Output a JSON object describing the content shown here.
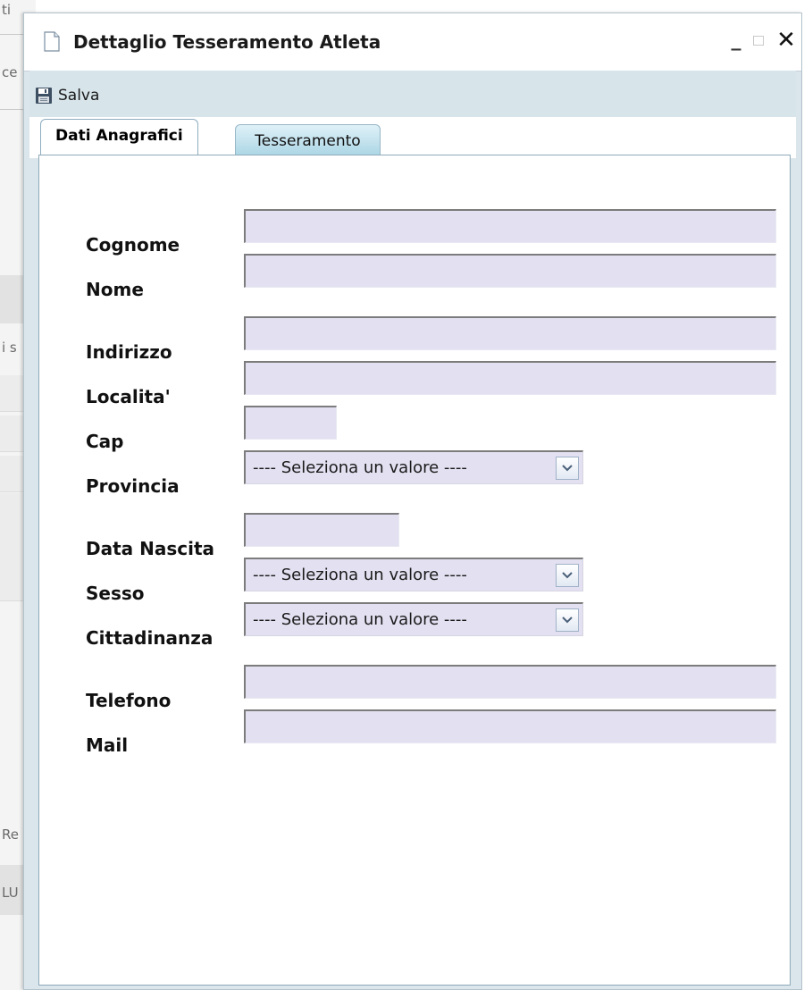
{
  "background": {
    "fragments": [
      "ti",
      "ce",
      "i s",
      "Re",
      "LU"
    ]
  },
  "window": {
    "title": "Dettaglio Tesseramento Atleta",
    "minimize_glyph": "_",
    "close_glyph": "✕"
  },
  "toolbar": {
    "save_label": "Salva",
    "save_icon": "floppy-disk-icon"
  },
  "tabs": [
    {
      "label": "Dati Anagrafici",
      "active": true
    },
    {
      "label": "Tesseramento",
      "active": false
    }
  ],
  "form": {
    "cognome": {
      "label": "Cognome",
      "value": ""
    },
    "nome": {
      "label": "Nome",
      "value": ""
    },
    "indirizzo": {
      "label": "Indirizzo",
      "value": ""
    },
    "localita": {
      "label": "Localita'",
      "value": ""
    },
    "cap": {
      "label": "Cap",
      "value": ""
    },
    "provincia": {
      "label": "Provincia",
      "selected": "---- Seleziona un valore ----"
    },
    "data_nascita": {
      "label": "Data Nascita",
      "value": ""
    },
    "sesso": {
      "label": "Sesso",
      "selected": "---- Seleziona un valore ----"
    },
    "cittadinanza": {
      "label": "Cittadinanza",
      "selected": "---- Seleziona un valore ----"
    },
    "telefono": {
      "label": "Telefono",
      "value": ""
    },
    "mail": {
      "label": "Mail",
      "value": ""
    }
  },
  "colors": {
    "input_bg": "#e3e0f1",
    "toolbar_bg": "#d7e4ea",
    "tab_inactive": "#a9d4e4"
  }
}
